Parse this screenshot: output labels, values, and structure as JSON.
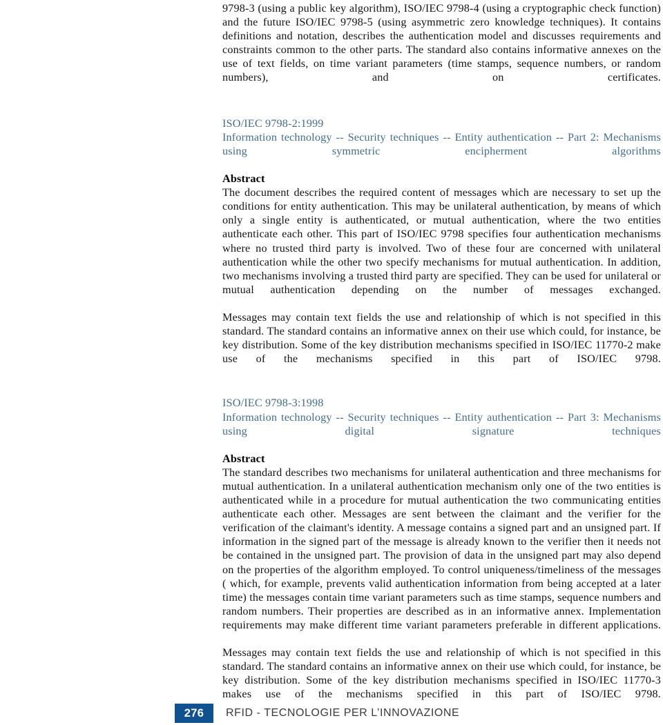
{
  "document": {
    "intro_paragraph": "9798-3 (using a public key algorithm), ISO/IEC 9798-4 (using a cryptographic check function) and the future ISO/IEC 9798-5 (using asymmetric zero knowledge techniques). It contains definitions and notation, describes the authentication model and discusses requirements and constraints common to the other parts. The standard also contains informative annexes on the use of text fields, on time variant parameters (time stamps, sequence numbers, or random numbers), and on certificates.",
    "abstract_label": "Abstract",
    "entries": [
      {
        "standard_id": "ISO/IEC 9798-2:1999",
        "standard_title": "Information technology -- Security techniques -- Entity authentication -- Part 2: Mechanisms using symmetric encipherment algorithms",
        "abstract_paragraphs": [
          "The document describes the required content of messages which are necessary to set up the conditions for entity authentication. This may be unilateral authentication, by means of which only a single entity is authenticated, or mutual authentication, where the two entities authenticate each other. This part of ISO/IEC 9798 specifies four authentication mechanisms where no trusted third party is involved. Two of these four are concerned with unilateral authentication while the other two specify mechanisms for mutual authentication. In addition, two mechanisms involving a trusted third party are specified. They can be used for unilateral or mutual authentication depending on the number of messages exchanged.",
          "Messages may contain text fields the use and relationship of which is not specified in this standard. The standard contains an informative annex on their use which could, for instance, be key distribution. Some of the key distribution mechanisms specified in ISO/IEC 11770-2 make use of the mechanisms specified in this part of ISO/IEC 9798."
        ]
      },
      {
        "standard_id": "ISO/IEC 9798-3:1998",
        "standard_title": "Information technology -- Security techniques -- Entity authentication -- Part 3: Mechanisms using digital signature techniques",
        "abstract_paragraphs": [
          "The standard describes two mechanisms for unilateral authentication and three mechanisms for mutual authentication. In a unilateral authentication mechanism only one of the two entities is authenticated while in a procedure for mutual authentication the two communicating entities authenticate each other. Messages are sent between the claimant and the verifier for the verification of the claimant's identity. A message contains a signed part and an unsigned part. If information in the signed part of the message is already known to the verifier then it needs not be contained in the unsigned part. The provision of data in the unsigned part may also depend on the properties of the algorithm employed. To control uniqueness/timeliness of the messages ( which, for example, prevents valid authentication information from being accepted at a later time) the messages contain time variant parameters such as time stamps, sequence numbers and random numbers. Their properties are described as in an informative annex. Implementation requirements may make different time variant parameters preferable in different applications.",
          "Messages may contain text fields the use and relationship of which is not specified in this standard. The standard contains an informative annex on their use which could, for instance, be key distribution. Some of the key distribution mechanisms specified in ISO/IEC 11770-3 makes use of the mechanisms specified in this part of ISO/IEC 9798."
        ]
      }
    ]
  },
  "footer": {
    "page_number": "276",
    "title": "RFID - TECNOLOGIE PER L’INNOVAZIONE",
    "page_number_box_color": "#10518f",
    "title_color": "#3a3a3a"
  },
  "colors": {
    "heading_blue": "#456c89",
    "body_black": "#141414",
    "page_background": "#ffffff"
  }
}
